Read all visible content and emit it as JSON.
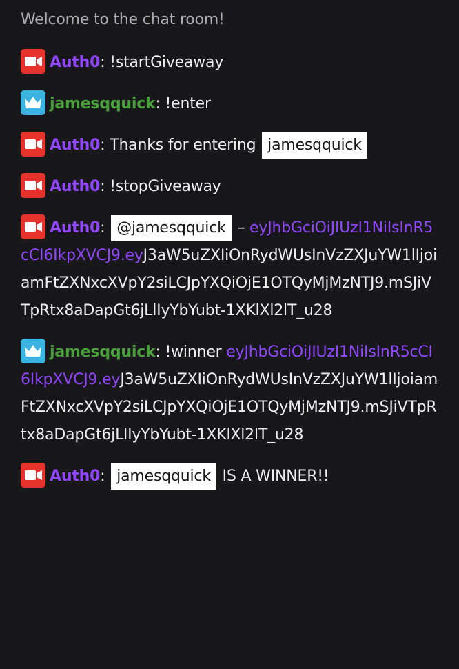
{
  "welcome": "Welcome to the chat room!",
  "messages": [
    {
      "badge": "camera-icon",
      "user": "Auth0",
      "text": "!startGiveaway"
    },
    {
      "badge": "crown-icon",
      "user": "jamesqquick",
      "text": "!enter"
    },
    {
      "badge": "camera-icon",
      "user": "Auth0",
      "text_before": "Thanks for entering",
      "mention": "jamesqquick"
    },
    {
      "badge": "camera-icon",
      "user": "Auth0",
      "text": "!stopGiveaway"
    },
    {
      "badge": "camera-icon",
      "user": "Auth0",
      "mention": "@jamesqquick",
      "separator": " –",
      "token_head": "eyJhbGciOiJIUzI1NiIsInR5cCI6IkpXVCJ9.ey",
      "token_rest": "J3aW5uZXIiOnRydWUsInVzZXJuYW1lIjoiamFtZXNxcXVpY2siLCJpYXQiOjE1OTQyMjMzNTJ9.mSJiVTpRtx8aDapGt6jLlIyYbYubt-1XKlXl2lT_u28"
    },
    {
      "badge": "crown-icon",
      "user": "jamesqquick",
      "text": "!winner",
      "token_head": "eyJhbGciOiJIUzI1NiIsInR5cCI6IkpXVCJ9.ey",
      "token_rest": "J3aW5uZXIiOnRydWUsInVzZXJuYW1lIjoiamFtZXNxcXVpY2siLCJpYXQiOjE1OTQyMjMzNTJ9.mSJiVTpRtx8aDapGt6jLlIyYbYubt-1XKlXl2lT_u28"
    },
    {
      "badge": "camera-icon",
      "user": "Auth0",
      "mention": "jamesqquick",
      "text_after": "IS A WINNER!!"
    }
  ],
  "colors": {
    "background": "#18181b",
    "auth0": "#9147ff",
    "jamesqquick": "#4aa13b",
    "camera_badge": "#e5322d",
    "crown_badge": "#3bb3e0"
  }
}
